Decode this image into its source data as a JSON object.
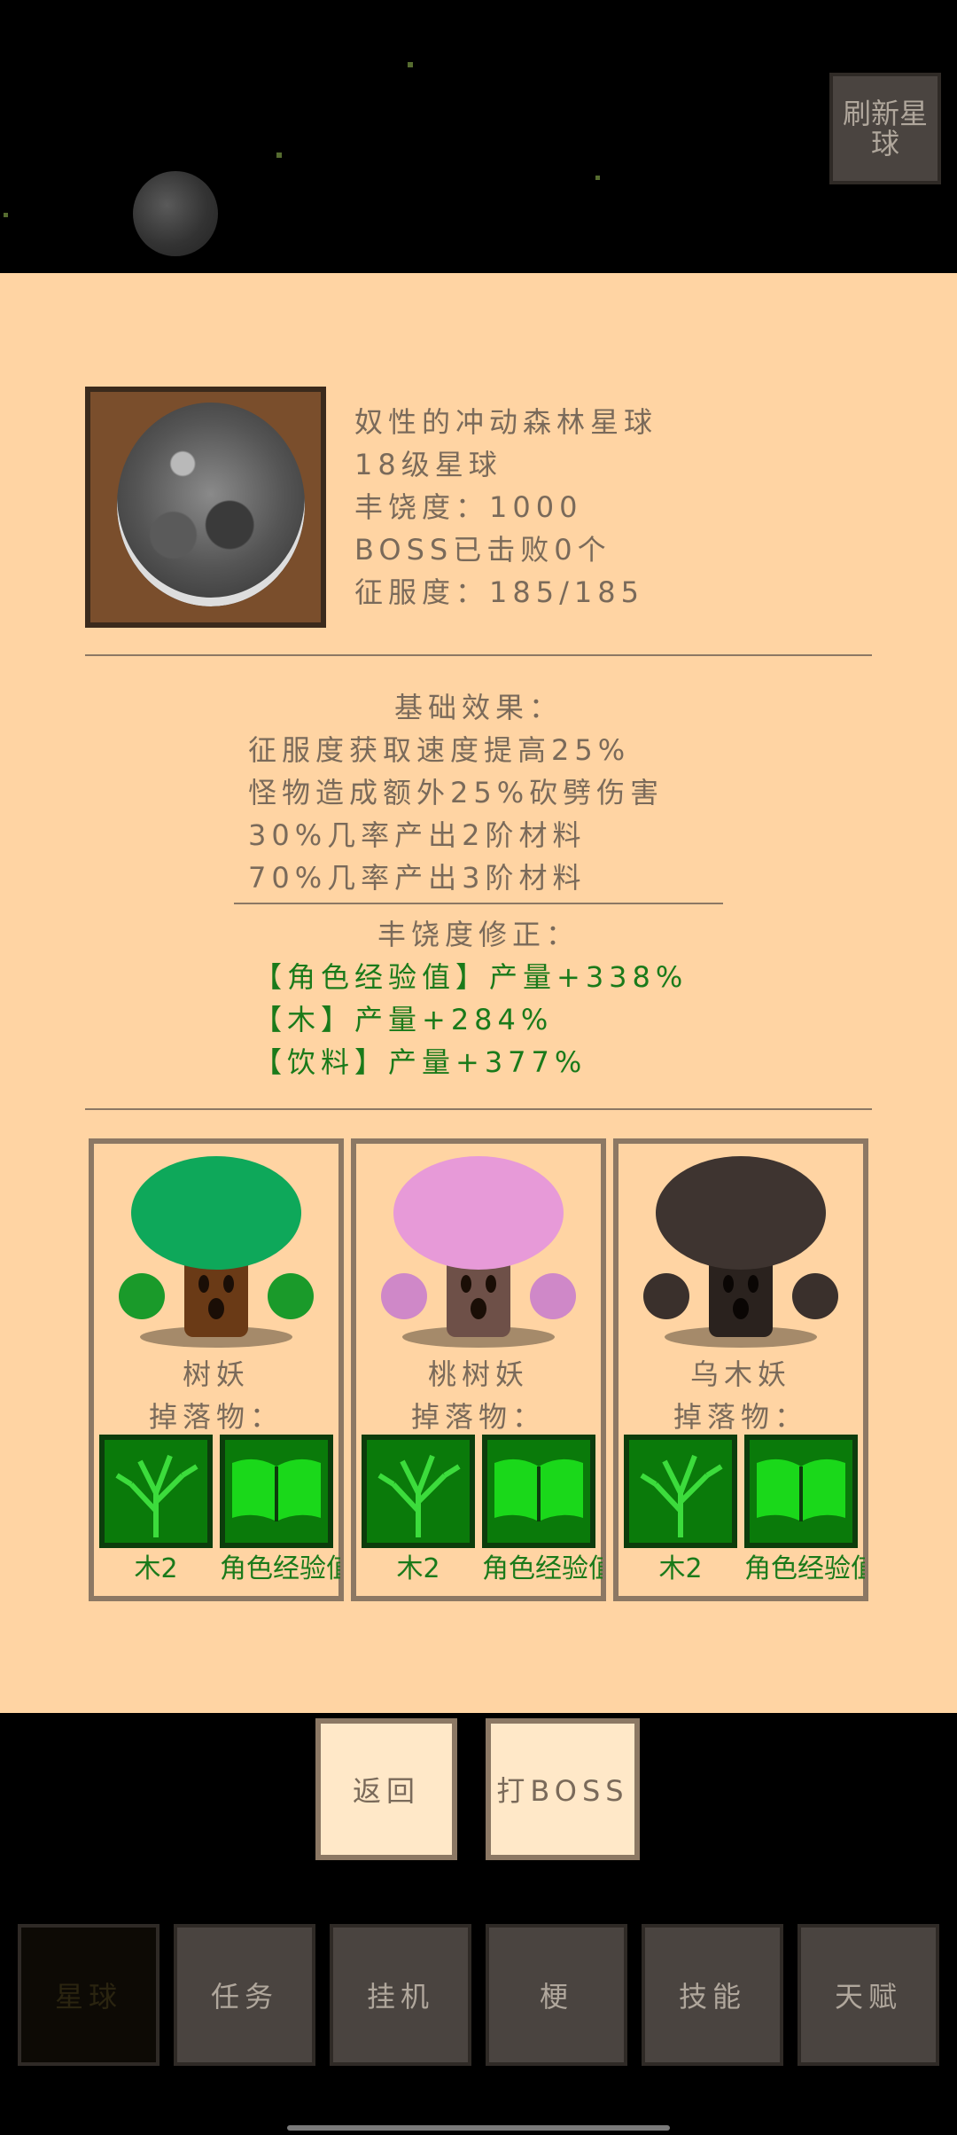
{
  "header": {
    "refresh_label": "刷新星球"
  },
  "planet": {
    "name": "奴性的冲动森林星球",
    "level": "18级星球",
    "richness": "丰饶度：1000",
    "boss": "BOSS已击败0个",
    "conquest": "征服度：185/185"
  },
  "base_effects": {
    "title": "基础效果：",
    "lines": [
      "征服度获取速度提高25%",
      "怪物造成额外25%砍劈伤害",
      "30%几率产出2阶材料",
      "70%几率产出3阶材料"
    ]
  },
  "richness_mods": {
    "title": "丰饶度修正：",
    "lines": [
      "【角色经验值】产量+338%",
      "【木】产量+284%",
      "【饮料】产量+377%"
    ]
  },
  "monsters": [
    {
      "name": "树妖",
      "drop_label": "掉落物：",
      "item1": "木2",
      "item2": "角色经验值",
      "crown_color": "#0ea85a",
      "trunk_color": "#6a3a16",
      "fist_color": "#1a9a2a"
    },
    {
      "name": "桃树妖",
      "drop_label": "掉落物：",
      "item1": "木2",
      "item2": "角色经验值",
      "crown_color": "#e79ad8",
      "trunk_color": "#6e5048",
      "fist_color": "#cf88c8"
    },
    {
      "name": "乌木妖",
      "drop_label": "掉落物：",
      "item1": "木2",
      "item2": "角色经验值",
      "crown_color": "#3e3430",
      "trunk_color": "#2a221e",
      "fist_color": "#3a302c"
    }
  ],
  "actions": {
    "back": "返回",
    "fight_boss": "打BOSS"
  },
  "nav": {
    "items": [
      "星球",
      "任务",
      "挂机",
      "梗",
      "技能",
      "天赋"
    ]
  },
  "colors": {
    "panel": "#ffd4a3",
    "text": "#7a6a5a",
    "green_text": "#1a7a1a",
    "item_bg": "#0a7a0a"
  }
}
